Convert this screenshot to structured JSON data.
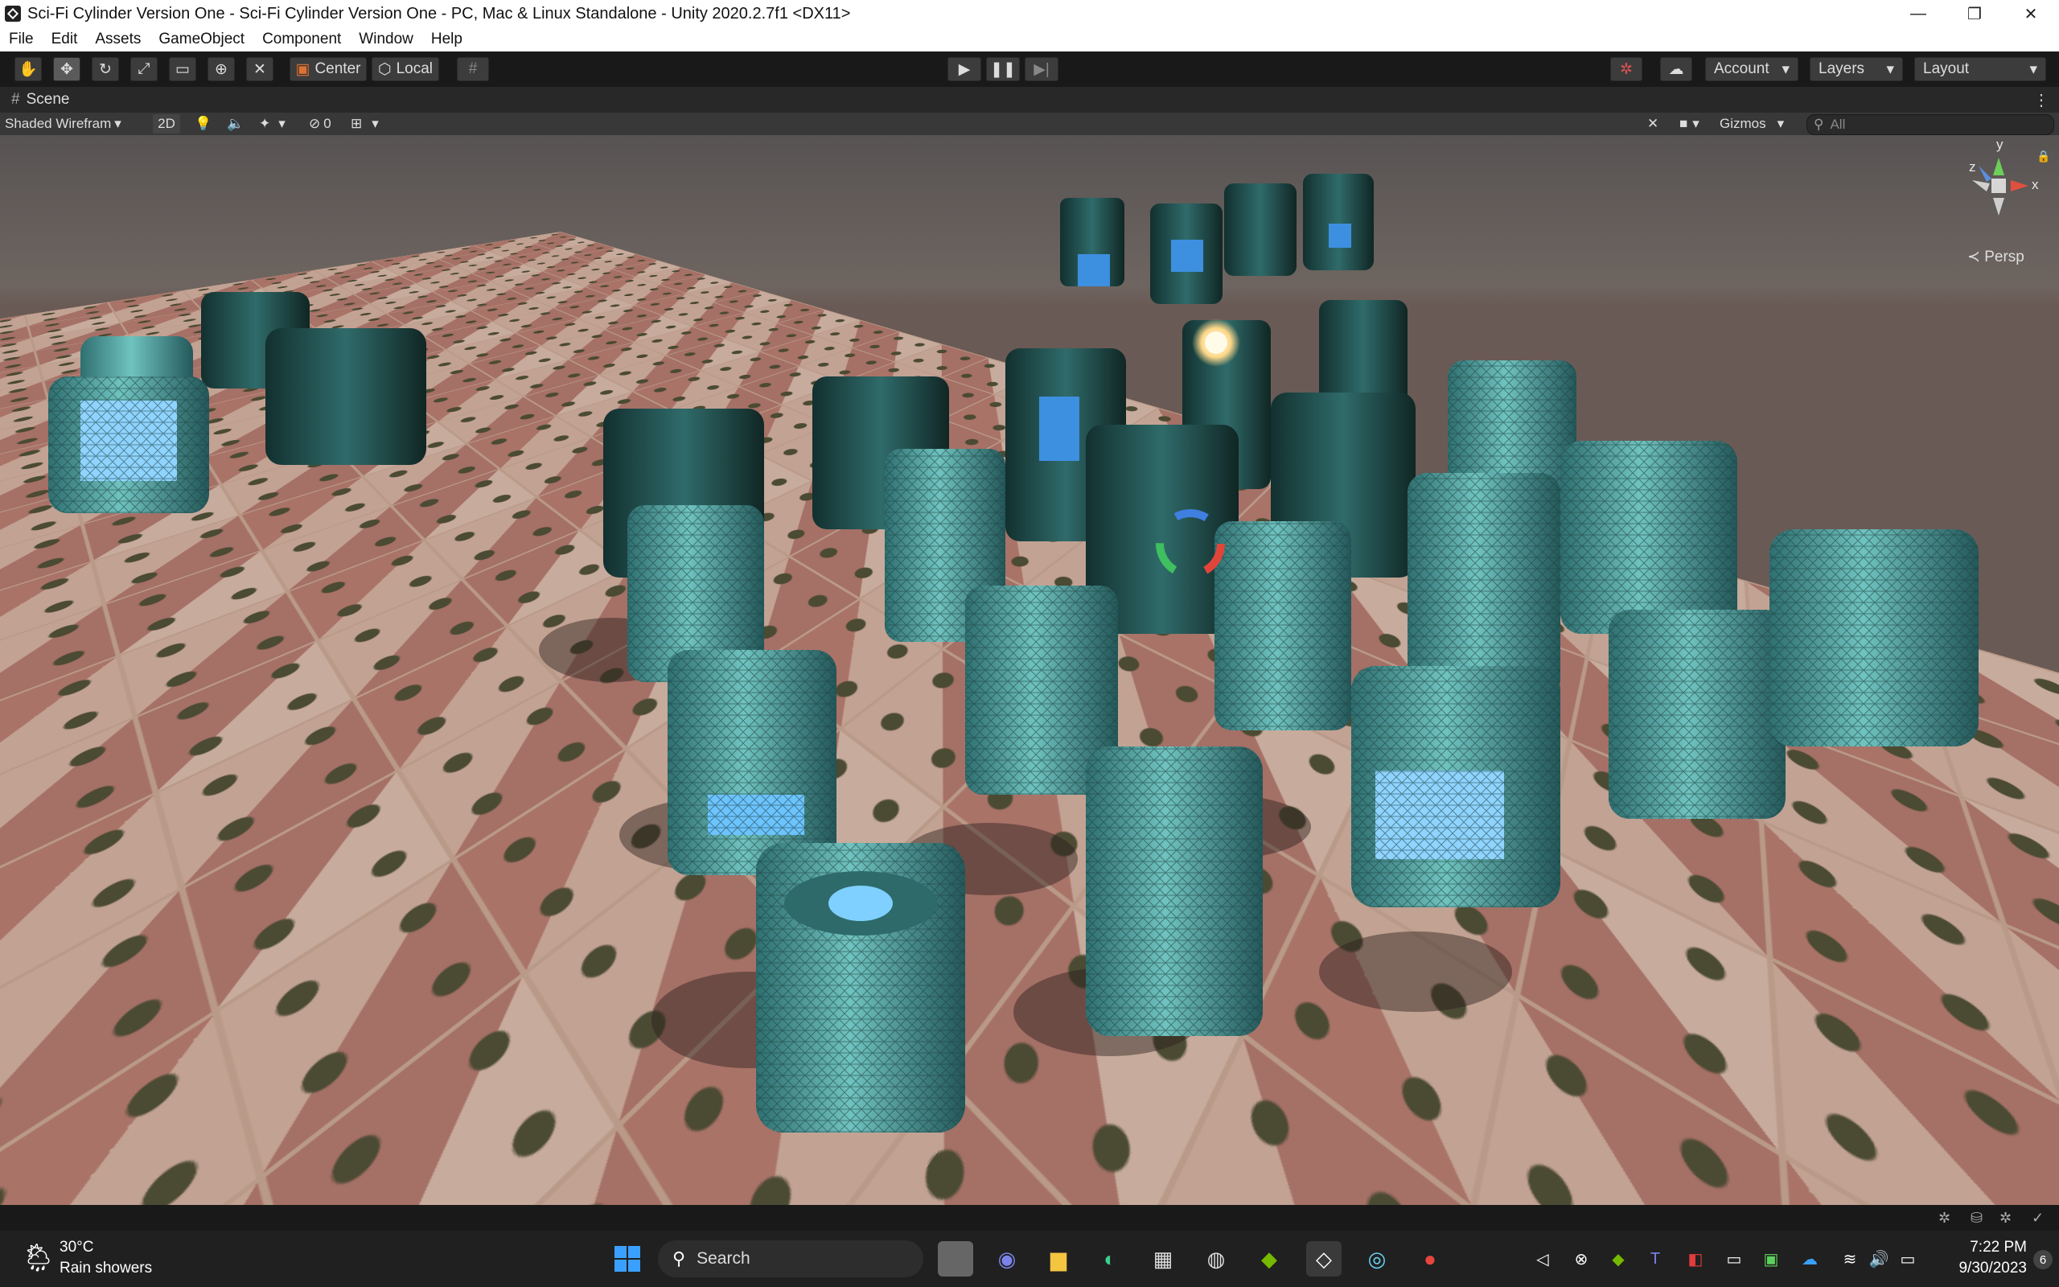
{
  "window": {
    "title": "Sci-Fi Cylinder Version One - Sci-Fi Cylinder Version One - PC, Mac & Linux Standalone - Unity 2020.2.7f1 <DX11>",
    "minimize": "—",
    "maximize": "❐",
    "close": "✕"
  },
  "menu": [
    "File",
    "Edit",
    "Assets",
    "GameObject",
    "Component",
    "Window",
    "Help"
  ],
  "toolbar": {
    "pivot_center": "Center",
    "pivot_local": "Local",
    "account": "Account",
    "layers": "Layers",
    "layout": "Layout"
  },
  "scene": {
    "tab_label": "Scene",
    "draw_mode": "Shaded Wirefram",
    "mode_2d": "2D",
    "hidden_count": "0",
    "gizmos": "Gizmos",
    "search_placeholder": "All",
    "view_label": "Persp",
    "axis_x": "x",
    "axis_y": "y",
    "axis_z": "z"
  },
  "taskbar": {
    "temperature": "30°C",
    "weather": "Rain showers",
    "search": "Search",
    "time": "7:22 PM",
    "date": "9/30/2023",
    "notifications": "6"
  },
  "colors": {
    "teal": "#4a9c9c",
    "glow": "#5fb6ff",
    "accent_blue": "#0a84ff"
  }
}
